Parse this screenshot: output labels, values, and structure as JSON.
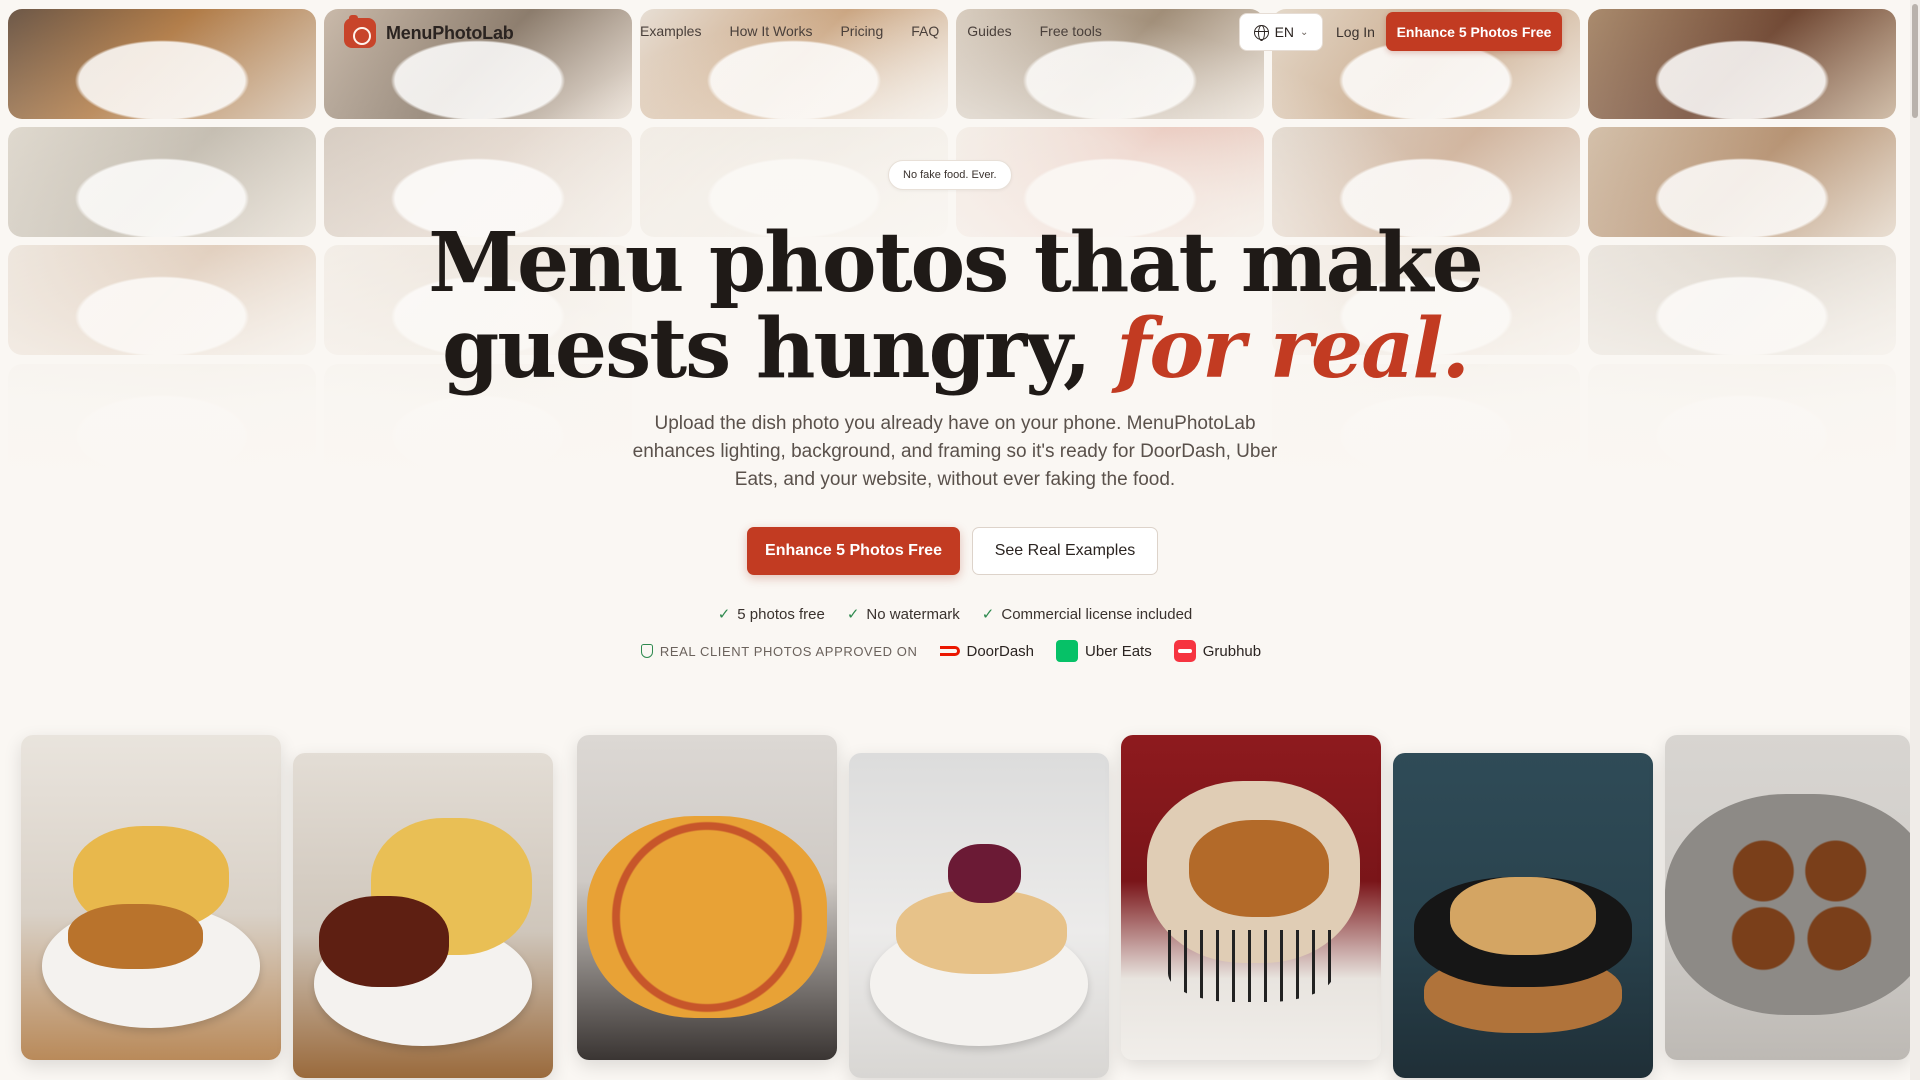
{
  "brand": {
    "name": "MenuPhotoLab"
  },
  "nav": {
    "links": [
      "Examples",
      "How It Works",
      "Pricing",
      "FAQ",
      "Guides",
      "Free tools"
    ],
    "language": "EN",
    "login": "Log In",
    "cta": "Enhance 5 Photos Free"
  },
  "hero": {
    "pill": "No fake food. Ever.",
    "headline_line1": "Menu photos that make",
    "headline_line2": "guests hungry,",
    "headline_accent": "for real.",
    "subtext": "Upload the dish photo you already have on your phone. MenuPhotoLab enhances lighting, background, and framing so it's ready for DoorDash, Uber Eats, and your website, without ever faking the food.",
    "primary_cta": "Enhance 5 Photos Free",
    "secondary_cta": "See Real Examples",
    "checks": [
      "5 photos free",
      "No watermark",
      "Commercial license included"
    ],
    "approved_label": "REAL CLIENT PHOTOS APPROVED ON",
    "platforms": [
      "DoorDash",
      "Uber Eats",
      "Grubhub"
    ]
  },
  "colors": {
    "brand_red": "#c23b22",
    "check_green": "#2f8a4f",
    "doordash": "#eb1700",
    "ubereats": "#06c167",
    "grubhub": "#f63440"
  },
  "food_cards": [
    "chicken-tenders-fries",
    "wings-fries",
    "pepperoni-pizza",
    "berry-pancakes",
    "fried-chicken-basket",
    "skillet-chicken-fajita",
    "arancini-skillet"
  ]
}
